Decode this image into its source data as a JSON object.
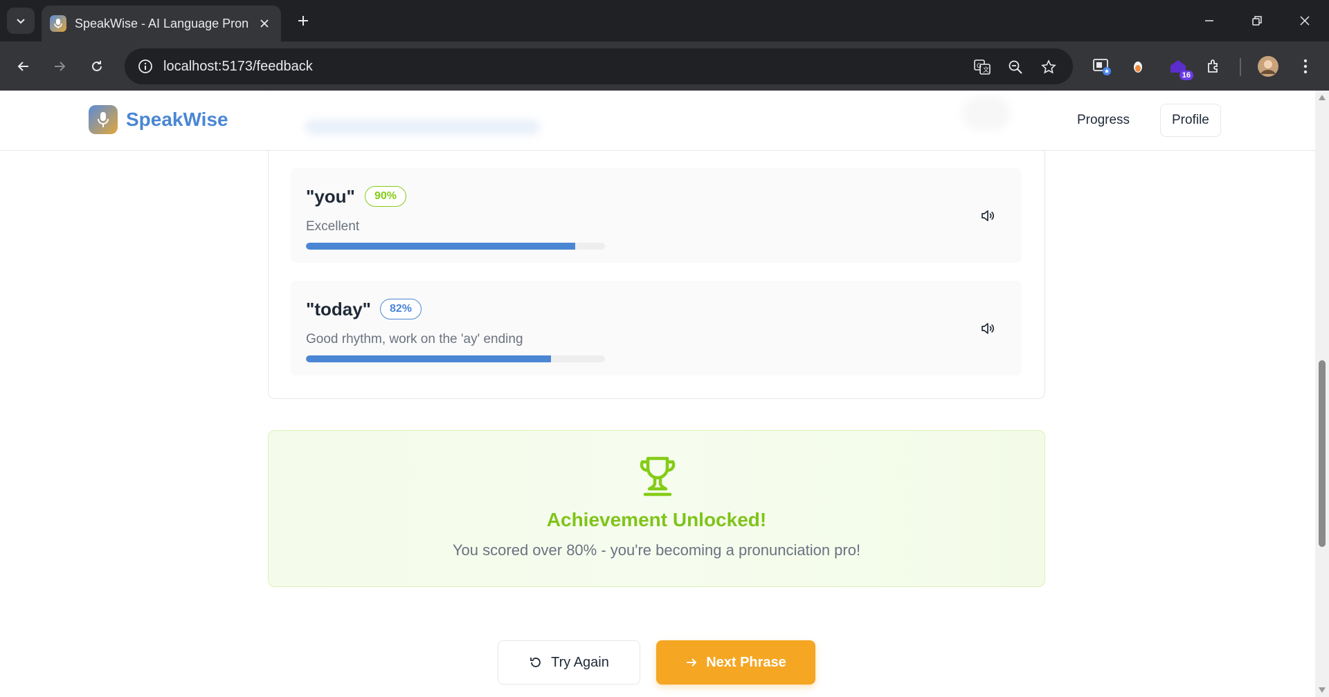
{
  "browser": {
    "tab_title": "SpeakWise - AI Language Pronunciation",
    "url": "localhost:5173/feedback",
    "extension_badge": "16"
  },
  "header": {
    "brand": "SpeakWise",
    "nav": {
      "progress": "Progress",
      "profile": "Profile"
    }
  },
  "words": [
    {
      "word": "\"you\"",
      "score": "90%",
      "score_value": 90,
      "feedback": "Excellent",
      "badge_color": "#84cc16"
    },
    {
      "word": "\"today\"",
      "score": "82%",
      "score_value": 82,
      "feedback": "Good rhythm, work on the 'ay' ending",
      "badge_color": "#4a86d4"
    }
  ],
  "achievement": {
    "title": "Achievement Unlocked!",
    "subtitle": "You scored over 80% - you're becoming a pronunciation pro!",
    "accent": "#7fc41a"
  },
  "actions": {
    "try_again": "Try Again",
    "next_phrase": "Next Phrase",
    "next_color": "#f5a623"
  }
}
